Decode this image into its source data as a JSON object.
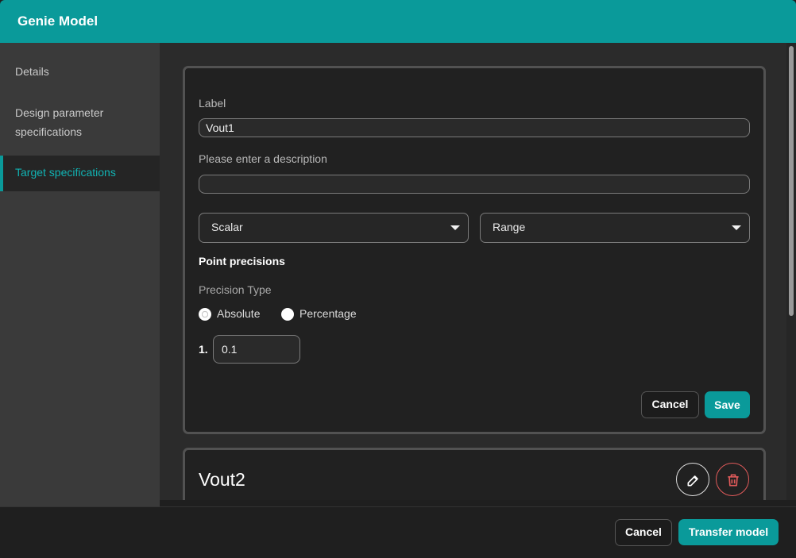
{
  "window": {
    "title": "Genie Model"
  },
  "sidebar": {
    "items": [
      {
        "label": "Details"
      },
      {
        "label_line1": "Design parameter",
        "label_line2": "specifications"
      },
      {
        "label": "Target specifications"
      }
    ]
  },
  "form": {
    "label_caption": "Label",
    "label_value": "Vout1",
    "description_caption": "Please enter a description",
    "description_value": "",
    "type_select": "Scalar",
    "kind_select": "Range",
    "point_precisions_title": "Point precisions",
    "precision_type_caption": "Precision Type",
    "radio_absolute": "Absolute",
    "radio_percentage": "Percentage",
    "selected_precision_type": "Absolute",
    "precision_items": [
      {
        "index": "1.",
        "value": "0.1"
      }
    ],
    "cancel_label": "Cancel",
    "save_label": "Save"
  },
  "collapsed_card": {
    "title": "Vout2",
    "icons": [
      "edit-icon",
      "trash-icon"
    ]
  },
  "footer": {
    "cancel_label": "Cancel",
    "transfer_label": "Transfer model"
  },
  "colors": {
    "accent": "#0a9a9a",
    "danger": "#e05a5a"
  }
}
